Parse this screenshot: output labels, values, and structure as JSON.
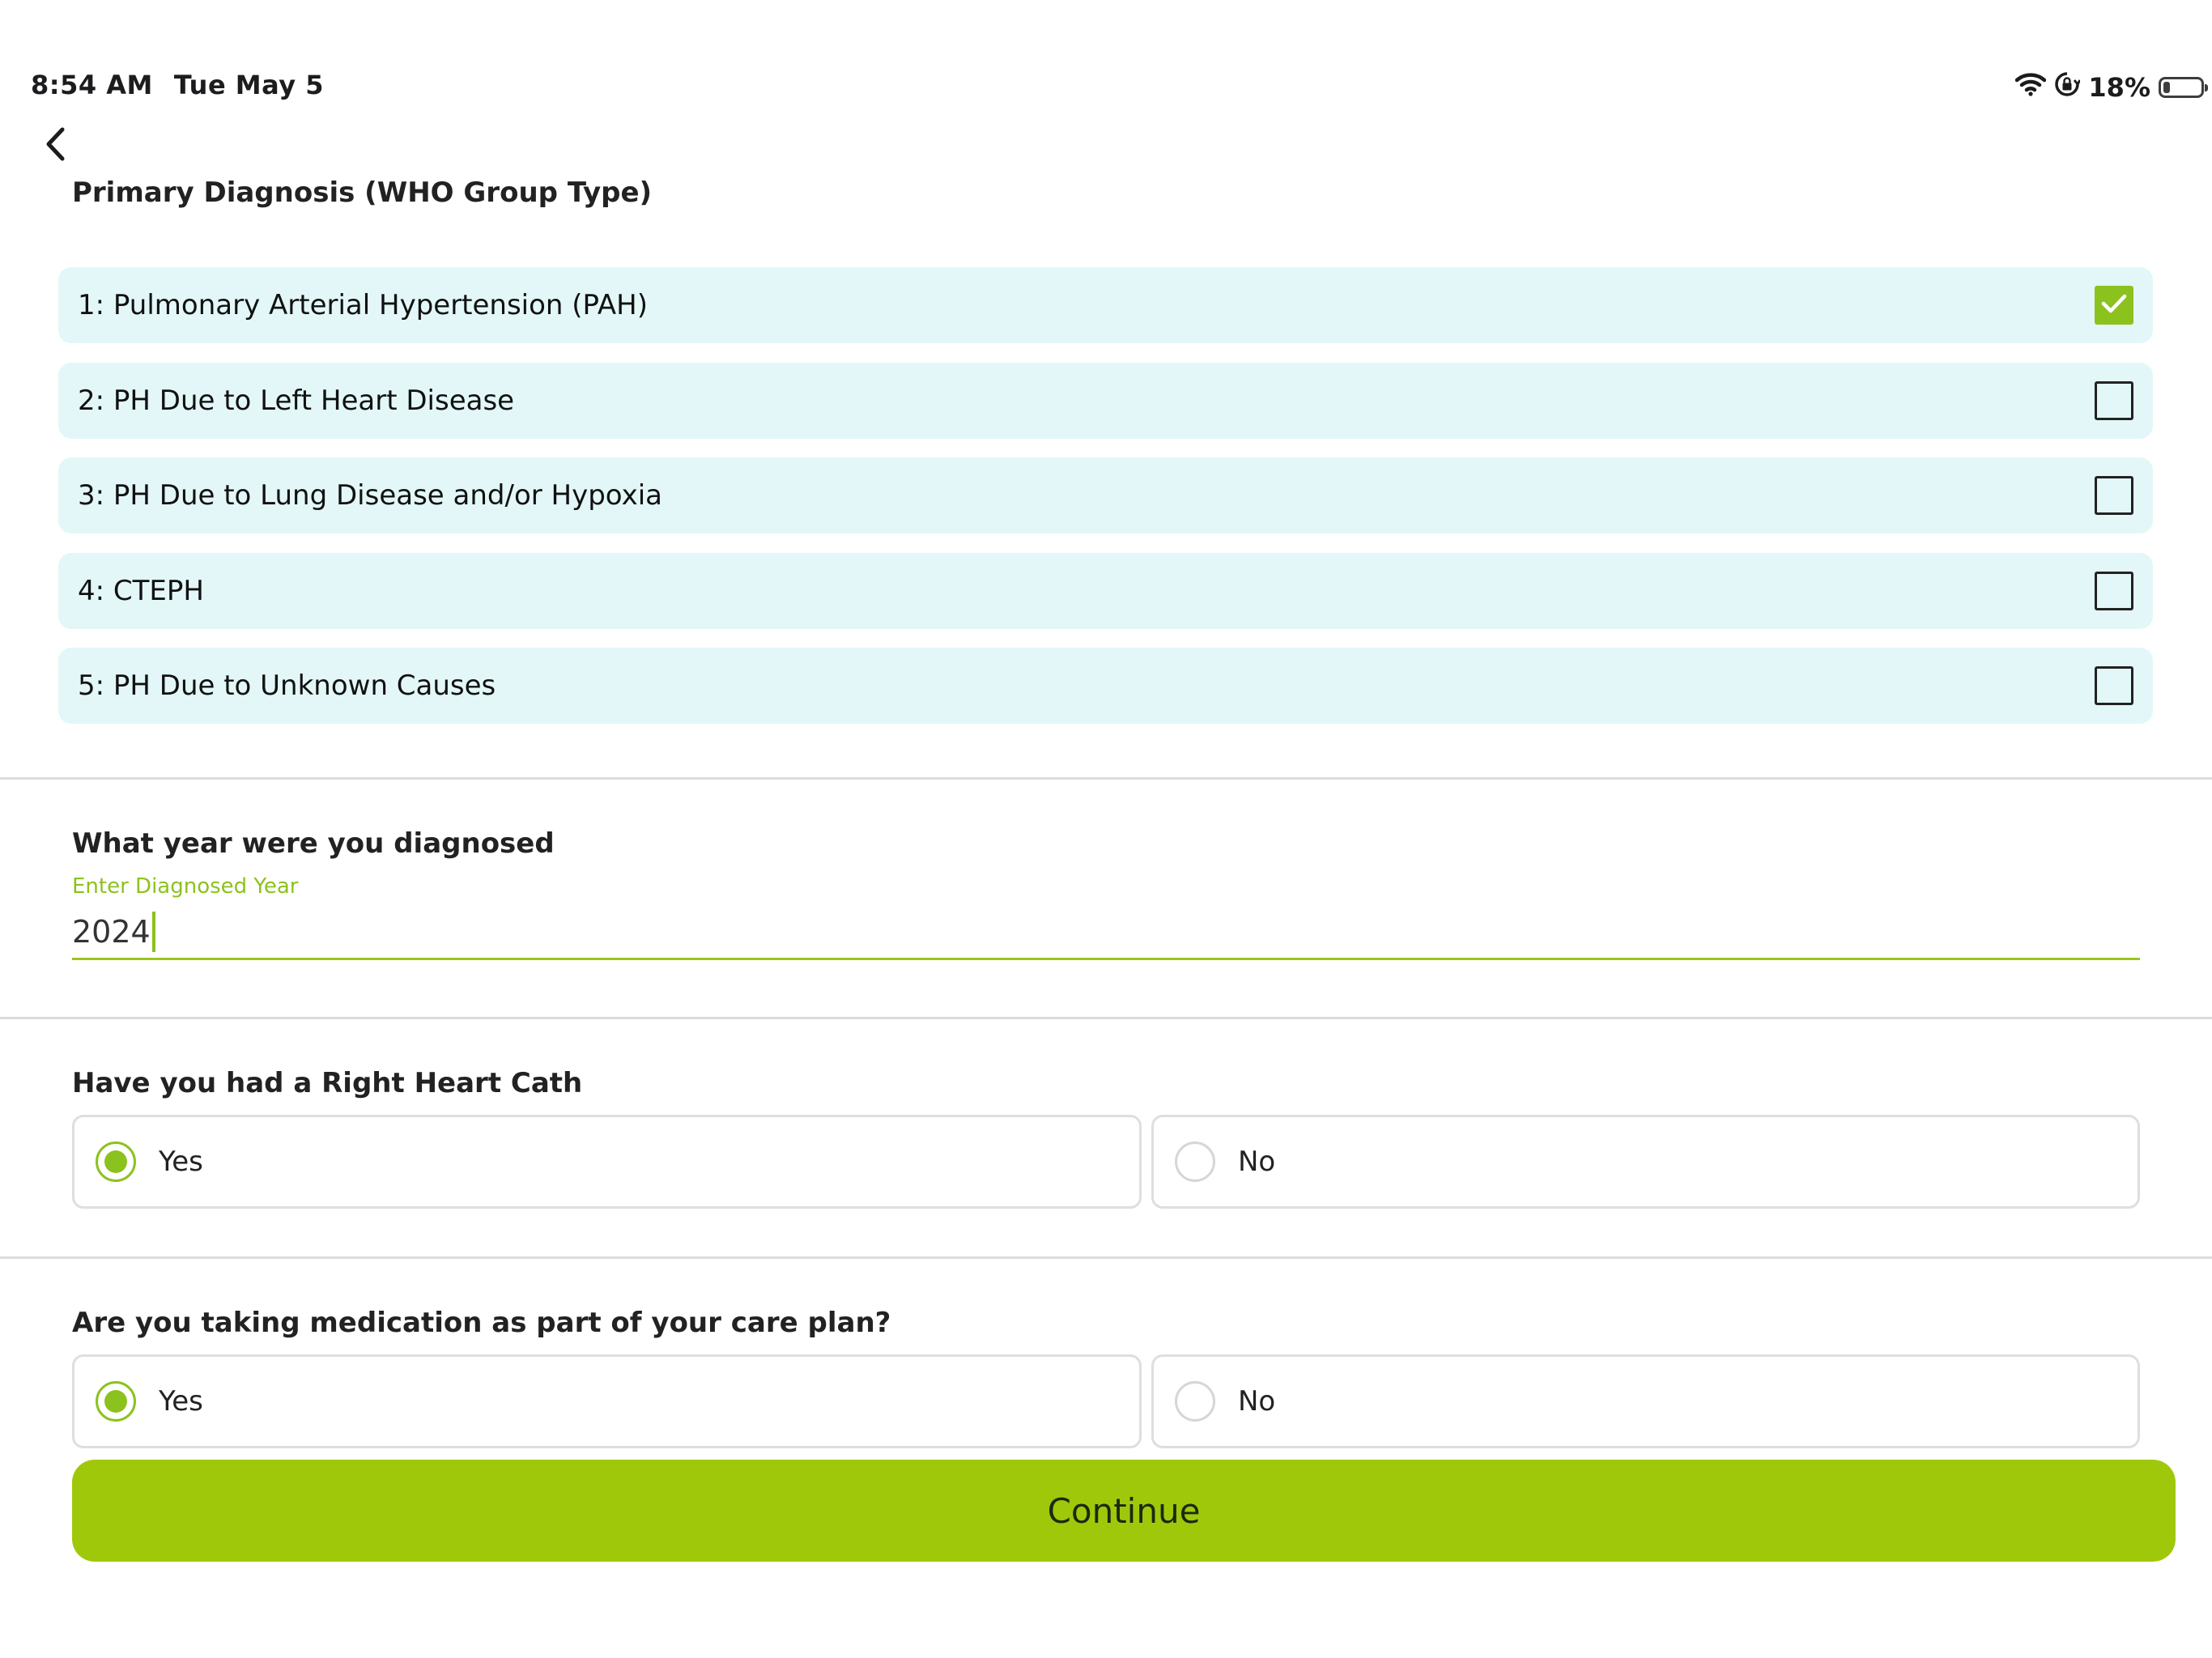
{
  "status_bar": {
    "time": "8:54 AM",
    "date": "Tue May 5",
    "battery_percent": "18%",
    "icons": [
      "wifi-icon",
      "orientation-lock-icon",
      "battery-icon"
    ],
    "battery_level": 0.18
  },
  "nav": {
    "back_icon": "chevron-left-icon"
  },
  "diagnosis": {
    "title": "Primary Diagnosis (WHO Group Type)",
    "options": [
      {
        "label": "1: Pulmonary Arterial Hypertension (PAH)",
        "checked": true
      },
      {
        "label": "2: PH Due to Left Heart Disease",
        "checked": false
      },
      {
        "label": "3: PH Due to Lung Disease and/or Hypoxia",
        "checked": false
      },
      {
        "label": "4: CTEPH",
        "checked": false
      },
      {
        "label": "5: PH Due to Unknown Causes",
        "checked": false
      }
    ]
  },
  "year": {
    "question": "What year were you diagnosed",
    "field_label": "Enter Diagnosed Year",
    "value": "2024"
  },
  "heart_cath": {
    "question": "Have you had a Right Heart Cath",
    "yes_label": "Yes",
    "no_label": "No",
    "selected": "Yes"
  },
  "medication": {
    "question": "Are you taking medication as part of your care plan?",
    "yes_label": "Yes",
    "no_label": "No",
    "selected": "Yes"
  },
  "continue_label": "Continue",
  "colors": {
    "accent": "#8cc21e",
    "button": "#a0c80a",
    "option_bg": "#e3f7f8"
  }
}
